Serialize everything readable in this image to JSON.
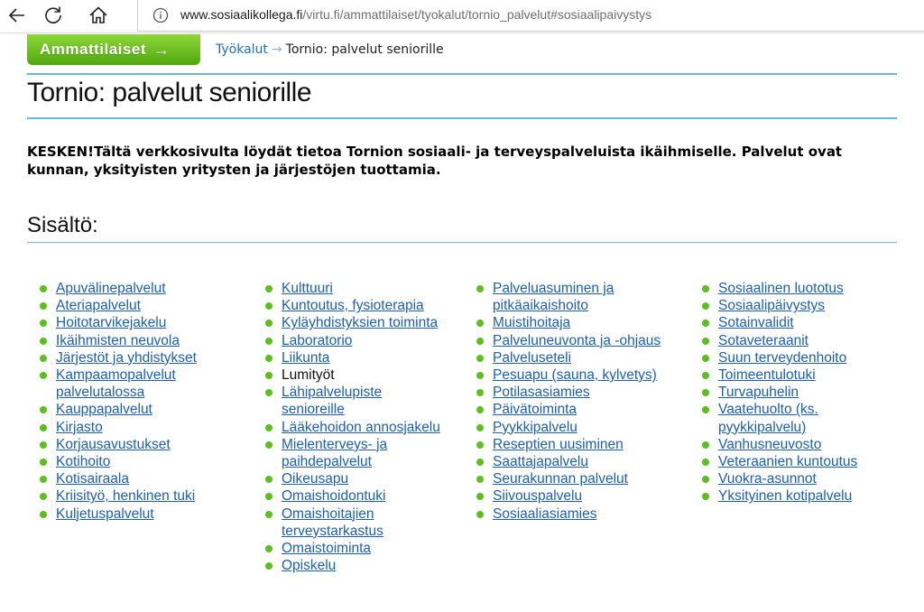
{
  "browser": {
    "url_host": "www.sosiaalikollega.fi",
    "url_path": "/virtu.fi/ammattilaiset/tyokalut/tornio_palvelut#sosiaalipaivystys",
    "icons": [
      "back-arrow-icon",
      "refresh-icon",
      "home-icon",
      "info-icon"
    ]
  },
  "header": {
    "green_button_label": "Ammattilaiset",
    "breadcrumb_link": "Työkalut",
    "breadcrumb_current": "Tornio: palvelut seniorille"
  },
  "page": {
    "title": "Tornio: palvelut seniorille",
    "intro": "KESKEN!Tältä verkkosivulta löydät tietoa Tornion sosiaali- ja terveyspalveluista ikäihmiselle. Palvelut ovat kunnan, yksityisten yritysten ja järjestöjen tuottamia.",
    "section_title": "Sisältö:"
  },
  "colors": {
    "link": "#1d5fb3",
    "bullet": "#5cbf1f",
    "rule": "#6bb7de",
    "button": "#6cc21f"
  },
  "columns": [
    [
      [
        "Apuvälinepalvelut"
      ],
      [
        "Ateriapalvelut"
      ],
      [
        "Hoitotarvikejakelu"
      ],
      [
        "Ikäihmisten neuvola"
      ],
      [
        "Järjestöt ja yhdistykset"
      ],
      [
        "Kampaamopalvelut",
        "palvelutalossa"
      ],
      [
        "Kauppapalvelut"
      ],
      [
        "Kirjasto"
      ],
      [
        "Korjausavustukset"
      ],
      [
        "Kotihoito"
      ],
      [
        "Kotisairaala"
      ],
      [
        "Kriisityö, henkinen tuki"
      ],
      [
        "Kuljetuspalvelut"
      ]
    ],
    [
      [
        "Kulttuuri"
      ],
      [
        "Kuntoutus, fysioterapia"
      ],
      [
        "Kyläyhdistyksien toiminta"
      ],
      [
        "Laboratorio"
      ],
      [
        "Liikunta"
      ],
      [
        "Lumityöt"
      ],
      [
        "Lähipalvelupiste",
        "senioreille"
      ],
      [
        "Lääkehoidon annosjakelu"
      ],
      [
        "Mielenterveys- ja",
        "paihdepalvelut"
      ],
      [
        "Oikeusapu"
      ],
      [
        "Omaishoidontuki"
      ],
      [
        "Omaishoitajien",
        "terveystarkastus"
      ],
      [
        "Omaistoiminta"
      ],
      [
        "Opiskelu"
      ]
    ],
    [
      [
        "Palveluasuminen ja",
        "pitkäaikaishoito"
      ],
      [
        "Muistihoitaja"
      ],
      [
        "Palveluneuvonta ja -ohjaus"
      ],
      [
        "Palveluseteli"
      ],
      [
        "Pesuapu (sauna, kylvetys)"
      ],
      [
        "Potilasasiamies"
      ],
      [
        "Päivätoiminta"
      ],
      [
        "Pyykkipalvelu"
      ],
      [
        "Reseptien uusiminen"
      ],
      [
        "Saattajapalvelu"
      ],
      [
        "Seurakunnan palvelut"
      ],
      [
        "Siivouspalvelu"
      ],
      [
        "Sosiaaliasiamies"
      ]
    ],
    [
      [
        "Sosiaalinen luototus"
      ],
      [
        "Sosiaalipäivystys"
      ],
      [
        "Sotainvalidit"
      ],
      [
        "Sotaveteraanit"
      ],
      [
        "Suun terveydenhoito"
      ],
      [
        "Toimeentulotuki"
      ],
      [
        "Turvapuhelin"
      ],
      [
        "Vaatehuolto (ks.",
        "pyykkipalvelu)"
      ],
      [
        "Vanhusneuvosto"
      ],
      [
        "Veteraanien kuntoutus"
      ],
      [
        "Vuokra-asunnot"
      ],
      [
        "Yksityinen kotipalvelu"
      ]
    ]
  ]
}
